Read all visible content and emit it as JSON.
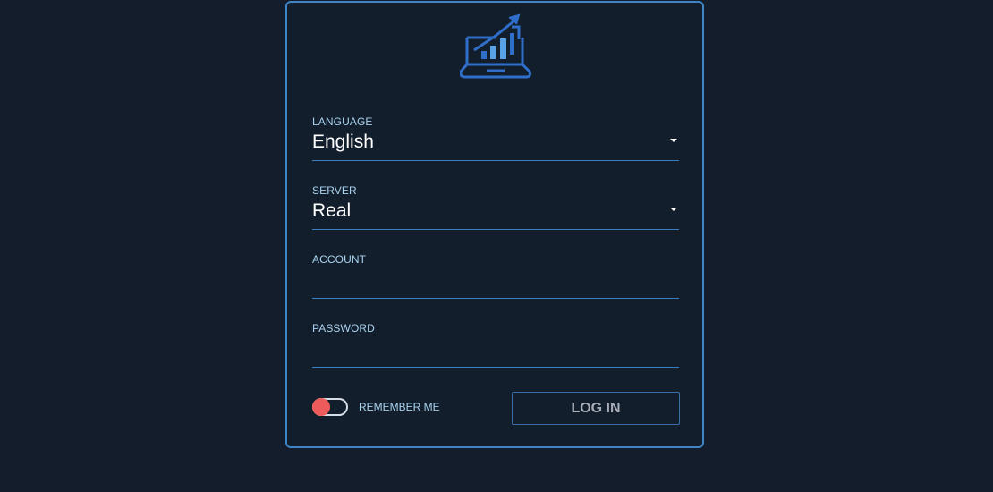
{
  "brand": {
    "logo_icon": "laptop-chart-icon",
    "accent_color": "#3f84c4",
    "icon_color": "#2f6fc9",
    "icon_light_color": "#5aa2e6"
  },
  "form": {
    "language": {
      "label": "LANGUAGE",
      "value": "English",
      "icon": "caret-down-icon"
    },
    "server": {
      "label": "SERVER",
      "value": "Real",
      "icon": "caret-down-icon"
    },
    "account": {
      "label": "ACCOUNT",
      "value": "",
      "placeholder": ""
    },
    "password": {
      "label": "PASSWORD",
      "value": "",
      "placeholder": ""
    },
    "remember_me": {
      "label": "REMEMBER ME",
      "toggle_color": "#ee5b5b",
      "state": "off"
    },
    "login_button": {
      "label": "LOG IN"
    }
  }
}
